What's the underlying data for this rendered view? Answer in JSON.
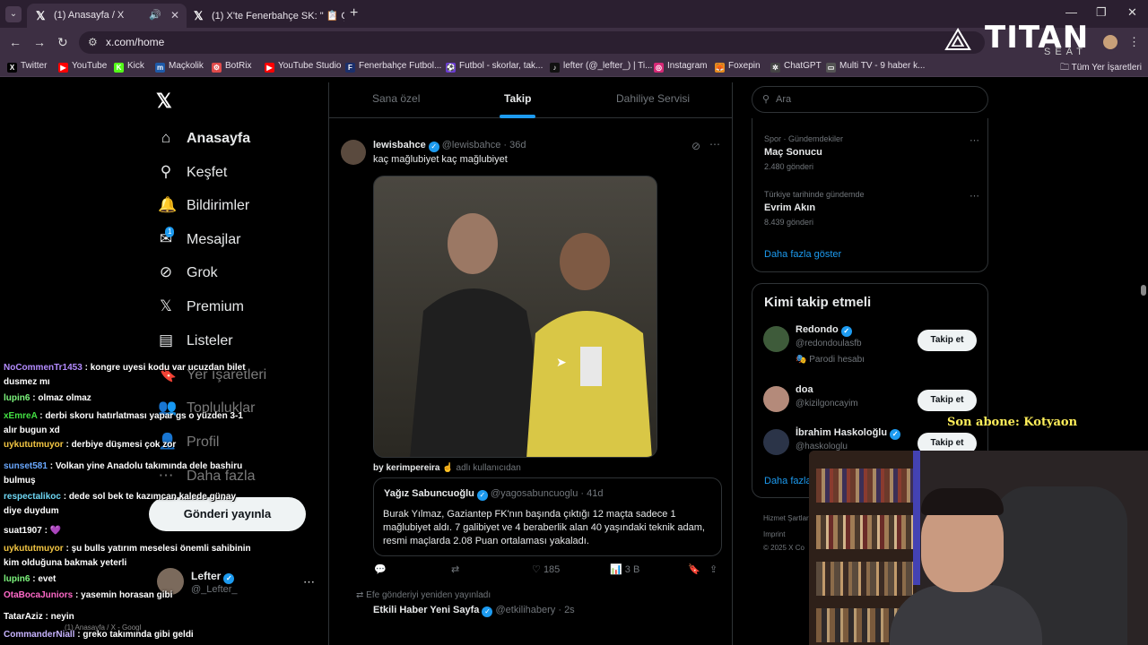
{
  "browser": {
    "tabs": [
      {
        "title": "(1) Anasayfa / X",
        "favicon": "x-icon",
        "active": true
      },
      {
        "title": "(1) X'te Fenerbahçe SK: \" 📋 Ç...",
        "favicon": "x-icon",
        "active": false
      }
    ],
    "url": "x.com/home",
    "bookmarks": [
      {
        "label": "Twitter",
        "color": "#000000",
        "glyph": "X"
      },
      {
        "label": "YouTube",
        "color": "#ff0000",
        "glyph": "▶"
      },
      {
        "label": "Kick",
        "color": "#53fc18",
        "glyph": "K"
      },
      {
        "label": "Maçkolik",
        "color": "#1e5aa8",
        "glyph": "m"
      },
      {
        "label": "BotRix",
        "color": "#e04b4b",
        "glyph": "⚙"
      },
      {
        "label": "YouTube Studio",
        "color": "#ff0000",
        "glyph": "▶"
      },
      {
        "label": "Fenerbahçe Futbol...",
        "color": "#1b2f6b",
        "glyph": "F"
      },
      {
        "label": "Futbol - skorlar, tak...",
        "color": "#6b3bd6",
        "glyph": "⚽"
      },
      {
        "label": "lefter (@_lefter_) | Ti...",
        "color": "#111111",
        "glyph": "♪"
      },
      {
        "label": "Instagram",
        "color": "#d62976",
        "glyph": "◎"
      },
      {
        "label": "Foxepin",
        "color": "#e58a1f",
        "glyph": "🦊"
      },
      {
        "label": "ChatGPT",
        "color": "#444444",
        "glyph": "✲"
      },
      {
        "label": "Multi TV - 9 haber k...",
        "color": "#555555",
        "glyph": "▭"
      }
    ],
    "all_bookmarks": "Tüm Yer İşaretleri"
  },
  "branding": {
    "word": "TITAN",
    "sub": "SEAT"
  },
  "nav": {
    "items": [
      {
        "label": "Anasayfa",
        "icon": "home-icon",
        "glyph": "⌂",
        "bold": true
      },
      {
        "label": "Keşfet",
        "icon": "search-icon",
        "glyph": "⚲",
        "bold": false
      },
      {
        "label": "Bildirimler",
        "icon": "bell-icon",
        "glyph": "🔔",
        "bold": false
      },
      {
        "label": "Mesajlar",
        "icon": "mail-icon",
        "glyph": "✉",
        "bold": false
      },
      {
        "label": "Grok",
        "icon": "grok-icon",
        "glyph": "⊘",
        "bold": false
      },
      {
        "label": "Premium",
        "icon": "x-premium-icon",
        "glyph": "𝕏",
        "bold": false
      },
      {
        "label": "Listeler",
        "icon": "list-icon",
        "glyph": "▤",
        "bold": false
      },
      {
        "label": "Yer İşaretleri",
        "icon": "bookmark-icon",
        "glyph": "🔖",
        "bold": false
      },
      {
        "label": "Topluluklar",
        "icon": "communities-icon",
        "glyph": "👥",
        "bold": false
      },
      {
        "label": "Profil",
        "icon": "profile-icon",
        "glyph": "👤",
        "bold": false
      },
      {
        "label": "Daha fazla",
        "icon": "more-icon",
        "glyph": "⋯",
        "bold": false
      }
    ],
    "post_button": "Gönderi yayınla",
    "messages_badge": "1"
  },
  "account": {
    "name": "Lefter",
    "handle": "@_Lefter_"
  },
  "feed": {
    "tabs": [
      "Sana özel",
      "Takip",
      "Dahiliye Servisi"
    ],
    "active_tab": "Takip",
    "post": {
      "name": "lewisbahce",
      "handle": "@lewisbahce",
      "time": "· 36d",
      "text": "kaç mağlubiyet kaç mağlubiyet",
      "caption_by": "by kerimpereira",
      "caption_rest": "adlı kullanıcıdan",
      "quote": {
        "name": "Yağız Sabuncuoğlu",
        "handle": "@yagosabuncuoglu",
        "time": "· 41d",
        "text": "Burak Yılmaz, Gaziantep FK'nın başında çıktığı 12 maçta sadece 1 mağlubiyet aldı. 7 galibiyet ve 4 beraberlik alan 40 yaşındaki teknik adam, resmi maçlarda 2.08 Puan ortalaması yakaladı."
      },
      "likes": "185",
      "views": "3 B"
    },
    "repost_note": "Efe gönderiyi yeniden yayınladı",
    "next_post_name": "Etkili Haber Yeni Sayfa",
    "next_post_handle": "@etkilihabery · 2s"
  },
  "sidebar": {
    "search_placeholder": "Ara",
    "trends": [
      {
        "category": "Spor · Gündemdekiler",
        "title": "Maç Sonucu",
        "count": "2.480 gönderi"
      },
      {
        "category": "Türkiye tarihinde gündemde",
        "title": "Evrim Akın",
        "count": "8.439 gönderi"
      }
    ],
    "show_more": "Daha fazla göster",
    "who_to_follow_title": "Kimi takip etmeli",
    "who": [
      {
        "name": "Redondo",
        "handle": "@redondoulasfb",
        "extra": "Parodi hesabı",
        "avatar_color": "#3e5b3a"
      },
      {
        "name": "doa",
        "handle": "@kizilgoncayim",
        "extra": "",
        "avatar_color": "#b48a7a"
      },
      {
        "name": "İbrahim Haskoloğlu",
        "handle": "@haskologlu",
        "extra": "",
        "avatar_color": "#2b3448"
      }
    ],
    "follow_label": "Takip et",
    "footer_links": "Hizmet Şartları",
    "footer_copy": "© 2025 X Co",
    "footer_imprint": "Imprint"
  },
  "chat": {
    "messages": [
      {
        "user": "NoCommenTr1453",
        "color": "#b48cff",
        "text": "kongre uyesi kodu var ucuzdan bilet dusmez mı"
      },
      {
        "user": "lupin6",
        "color": "#7df57d",
        "text": "olmaz olmaz"
      },
      {
        "user": "xEmreA",
        "color": "#43e043",
        "text": "derbi skoru hatırlatması yapar gs o yüzden 3-1 alır bugun xd"
      },
      {
        "user": "uykututmuyor",
        "color": "#f3c643",
        "text": "derbiye düşmesi çok zor"
      },
      {
        "user": "sunset581",
        "color": "#6aa8ff",
        "text": "Volkan yine Anadolu takımında dele bashiru bulmuş"
      },
      {
        "user": "respectalikoc",
        "color": "#6fd8f5",
        "text": "dede sol bek te kazımcan kalede günay diye duydum"
      },
      {
        "user": "suat1907",
        "color": "#ffffff",
        "text": "💜"
      },
      {
        "user": "uykututmuyor",
        "color": "#f3c643",
        "text": "şu bulls yatırım meselesi önemli sahibinin kim olduğuna bakmak yeterli"
      },
      {
        "user": "lupin6",
        "color": "#7df57d",
        "text": "evet"
      },
      {
        "user": "OtaBocaJuniors",
        "color": "#ff69c8",
        "text": "yasemin horasan gibi"
      },
      {
        "user": "TatarAziz",
        "color": "#ffffff",
        "text": "neyin"
      },
      {
        "user": "CommanderNiall",
        "color": "#c7b3ff",
        "text": "greko takımında gibi geldi"
      }
    ]
  },
  "overlay": {
    "sub_alert": "Son abone: Kotyaon"
  },
  "taskbar": {
    "hint": "(1) Anasayfa / X - Googl"
  }
}
